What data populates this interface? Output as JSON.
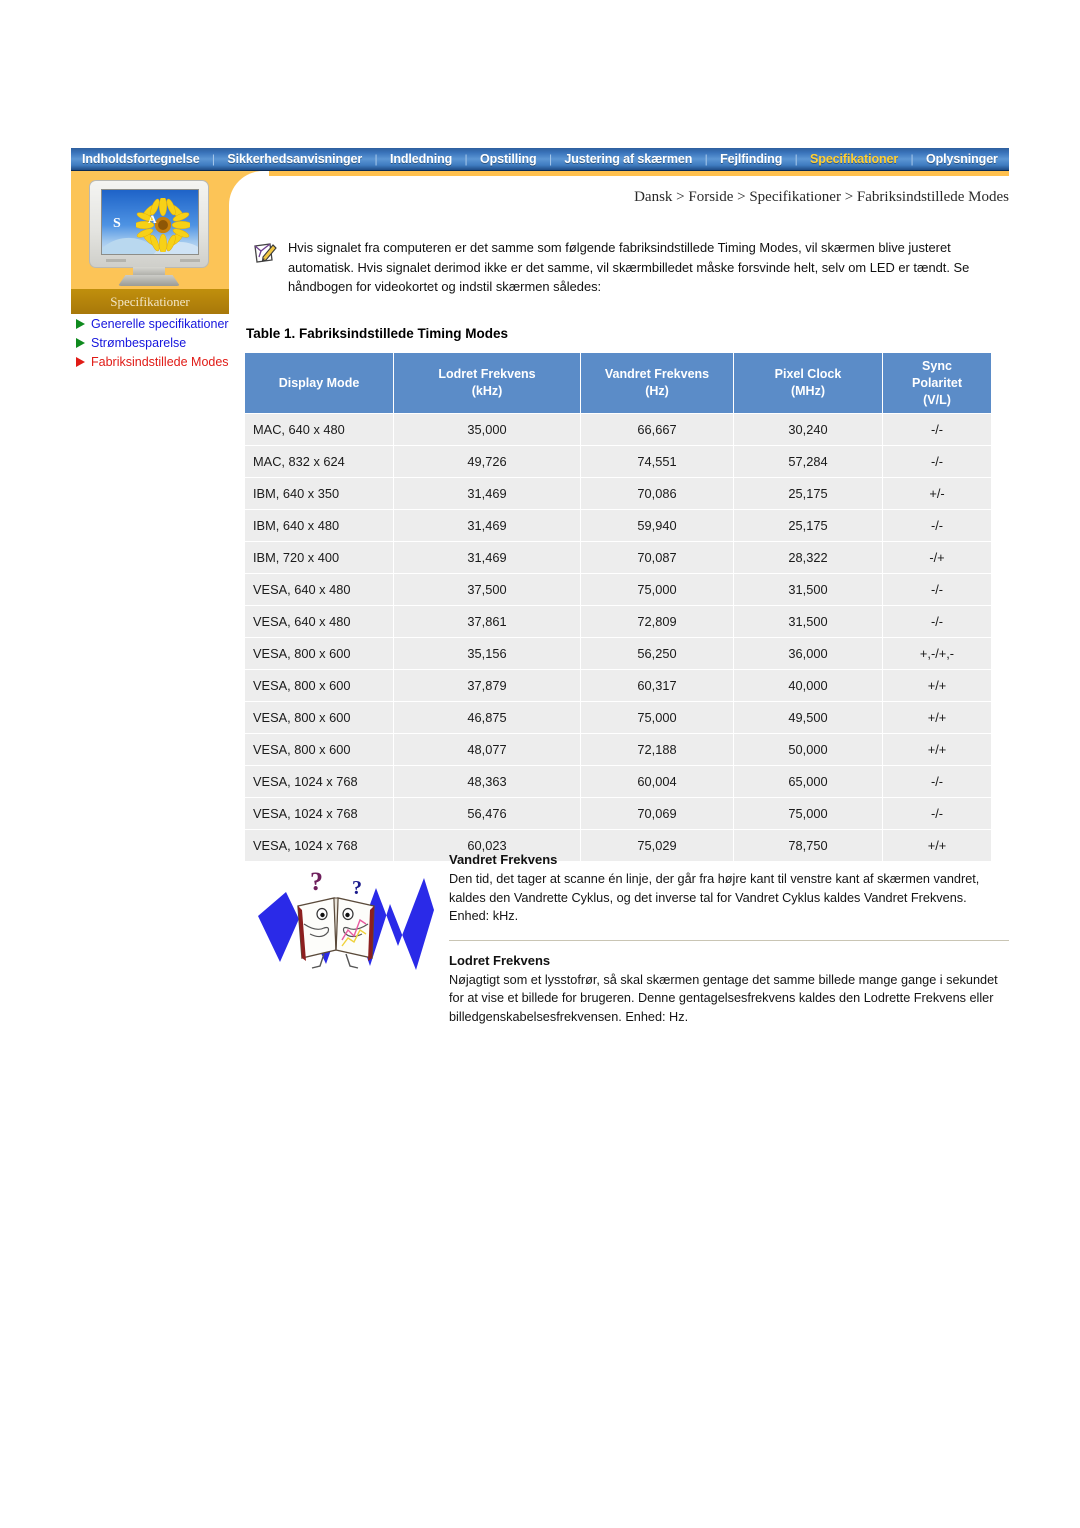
{
  "topnav": {
    "items": [
      {
        "label": "Indholdsfortegnelse",
        "active": false
      },
      {
        "label": "Sikkerhedsanvisninger",
        "active": false
      },
      {
        "label": "Indledning",
        "active": false
      },
      {
        "label": "Opstilling",
        "active": false
      },
      {
        "label": "Justering af skærmen",
        "active": false
      },
      {
        "label": "Fejlfinding",
        "active": false
      },
      {
        "label": "Specifikationer",
        "active": true
      },
      {
        "label": "Oplysninger",
        "active": false
      }
    ],
    "separator": "|",
    "active_color": "#ffcf33",
    "bar_color": "#3a74bb"
  },
  "sidebar": {
    "panel_label": "Specifikationer",
    "panel_color": "#fcc457",
    "items": [
      {
        "label": "Generelle specifikationer",
        "active": false
      },
      {
        "label": "Strømbesparelse",
        "active": false
      },
      {
        "label": "Fabriksindstillede Modes",
        "active": true
      }
    ],
    "monitor_badge_s": "S",
    "monitor_badge_a": "A"
  },
  "breadcrumb": "Dansk > Forside > Specifikationer > Fabriksindstillede Modes",
  "note": {
    "text": "Hvis signalet fra computeren er det samme som følgende fabriksindstillede Timing Modes, vil skærmen blive justeret automatisk. Hvis signalet derimod ikke er det samme, vil skærmbilledet måske forsvinde helt, selv om LED er tændt. Se håndbogen for videokortet og indstil skærmen således:"
  },
  "table": {
    "title": "Table 1. Fabriksindstillede Timing Modes",
    "header_color": "#5b8cc8",
    "columns": [
      {
        "line1": "Display Mode",
        "line2": "",
        "line3": ""
      },
      {
        "line1": "Lodret Frekvens",
        "line2": "(kHz)",
        "line3": ""
      },
      {
        "line1": "Vandret Frekvens",
        "line2": "(Hz)",
        "line3": ""
      },
      {
        "line1": "Pixel Clock",
        "line2": "(MHz)",
        "line3": ""
      },
      {
        "line1": "Sync",
        "line2": "Polaritet",
        "line3": "(V/L)"
      }
    ],
    "rows": [
      {
        "mode": "MAC, 640 x 480",
        "lodret": "35,000",
        "vandret": "66,667",
        "pixel": "30,240",
        "sync": "-/-"
      },
      {
        "mode": "MAC, 832 x 624",
        "lodret": "49,726",
        "vandret": "74,551",
        "pixel": "57,284",
        "sync": "-/-"
      },
      {
        "mode": "IBM, 640 x 350",
        "lodret": "31,469",
        "vandret": "70,086",
        "pixel": "25,175",
        "sync": "+/-"
      },
      {
        "mode": "IBM, 640 x 480",
        "lodret": "31,469",
        "vandret": "59,940",
        "pixel": "25,175",
        "sync": "-/-"
      },
      {
        "mode": "IBM, 720 x 400",
        "lodret": "31,469",
        "vandret": "70,087",
        "pixel": "28,322",
        "sync": "-/+"
      },
      {
        "mode": "VESA, 640 x 480",
        "lodret": "37,500",
        "vandret": "75,000",
        "pixel": "31,500",
        "sync": "-/-"
      },
      {
        "mode": "VESA, 640 x 480",
        "lodret": "37,861",
        "vandret": "72,809",
        "pixel": "31,500",
        "sync": "-/-"
      },
      {
        "mode": "VESA, 800 x 600",
        "lodret": "35,156",
        "vandret": "56,250",
        "pixel": "36,000",
        "sync": "+,-/+,-"
      },
      {
        "mode": "VESA, 800 x 600",
        "lodret": "37,879",
        "vandret": "60,317",
        "pixel": "40,000",
        "sync": "+/+"
      },
      {
        "mode": "VESA, 800 x 600",
        "lodret": "46,875",
        "vandret": "75,000",
        "pixel": "49,500",
        "sync": "+/+"
      },
      {
        "mode": "VESA, 800 x 600",
        "lodret": "48,077",
        "vandret": "72,188",
        "pixel": "50,000",
        "sync": "+/+"
      },
      {
        "mode": "VESA, 1024 x 768",
        "lodret": "48,363",
        "vandret": "60,004",
        "pixel": "65,000",
        "sync": "-/-"
      },
      {
        "mode": "VESA, 1024 x 768",
        "lodret": "56,476",
        "vandret": "70,069",
        "pixel": "75,000",
        "sync": "-/-"
      },
      {
        "mode": "VESA, 1024 x 768",
        "lodret": "60,023",
        "vandret": "75,029",
        "pixel": "78,750",
        "sync": "+/+"
      }
    ]
  },
  "sections": [
    {
      "heading": "Vandret Frekvens",
      "body": "Den tid, det tager at scanne én linje, der går fra højre kant til venstre kant af skærmen vandret, kaldes den Vandrette Cyklus, og det inverse tal for Vandret Cyklus kaldes Vandret Frekvens. Enhed: kHz."
    },
    {
      "heading": "Lodret Frekvens",
      "body": "Nøjagtigt som et lysstofrør, så skal skærmen gentage det samme billede mange gange i sekundet for at vise et billede for brugeren. Denne gentagelsesfrekvens kaldes den Lodrette Frekvens eller billedgenskabelsesfrekvensen. Enhed: Hz."
    }
  ]
}
